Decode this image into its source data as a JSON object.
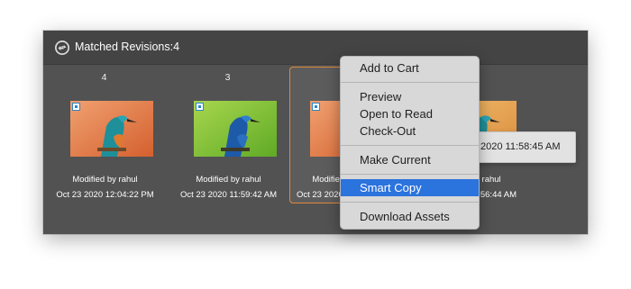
{
  "panel": {
    "title": "Matched Revisions:4",
    "icon": "revisions-icon"
  },
  "cards": [
    {
      "rev": "4",
      "modified_by": "Modified by rahul",
      "date": "Oct 23 2020 12:04:22 PM",
      "thumb_bg": "#e07a45",
      "selected": false
    },
    {
      "rev": "3",
      "modified_by": "Modified by rahul",
      "date": "Oct 23 2020 11:59:42 AM",
      "thumb_bg": "#8cc43a",
      "selected": false
    },
    {
      "rev": "",
      "modified_by": "Modified by rahul",
      "date": "Oct 23 2020 11:58:45 AM",
      "thumb_bg": "#e07a45",
      "selected": true
    },
    {
      "rev": "",
      "modified_by": "Modified by rahul",
      "date": "Oct 23 2020 11:56:44 AM",
      "thumb_bg": "#e0a84a",
      "selected": false
    }
  ],
  "context_menu": {
    "items": [
      "Add to Cart",
      "Preview",
      "Open to Read",
      "Check-Out",
      "Make Current",
      "Smart Copy",
      "Download Assets"
    ],
    "active_item": "Smart Copy"
  },
  "tooltip": {
    "text": "2020 11:58:45 AM"
  },
  "colors": {
    "accent": "#2b73dd",
    "selection_border": "#e08a3e",
    "panel_bg": "#525252"
  }
}
